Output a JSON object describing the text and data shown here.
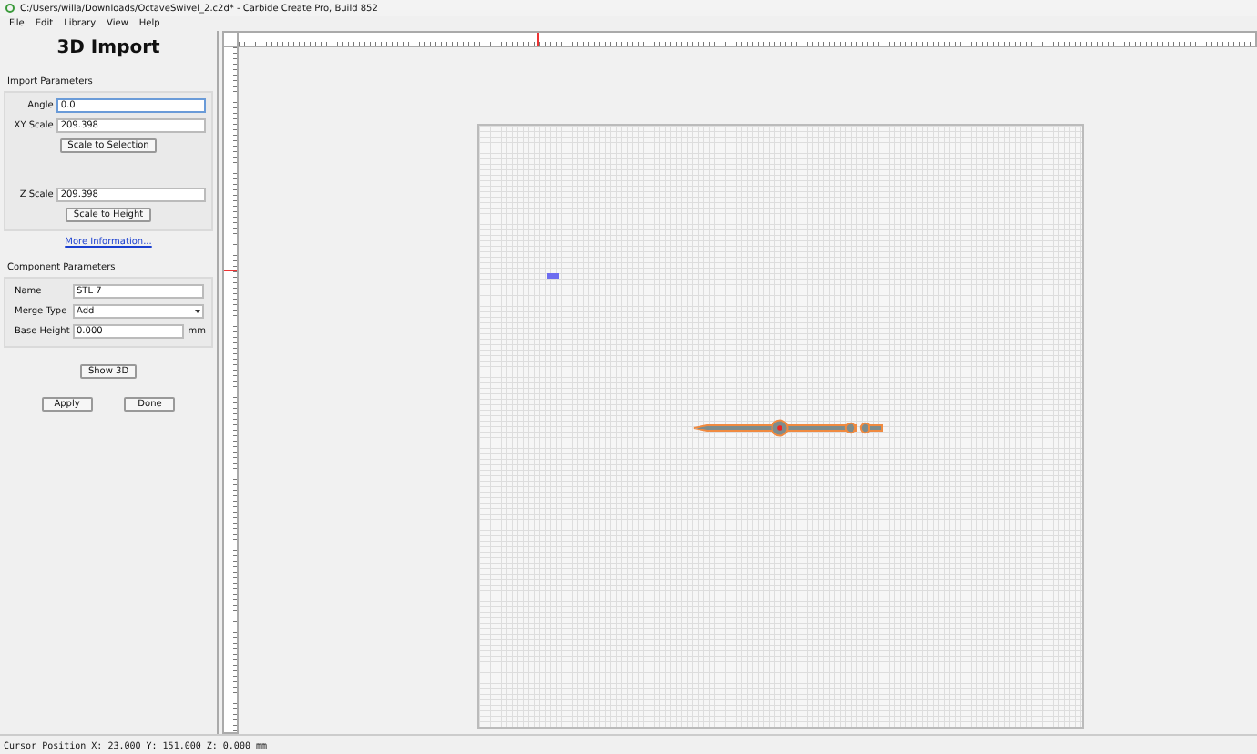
{
  "window": {
    "title": "C:/Users/willa/Downloads/OctaveSwivel_2.c2d* - Carbide Create Pro, Build 852"
  },
  "menu": [
    "File",
    "Edit",
    "Library",
    "View",
    "Help"
  ],
  "panel": {
    "title": "3D Import",
    "import_parameters": {
      "heading": "Import Parameters",
      "fields": [
        {
          "label": "Angle",
          "value": "0.0",
          "focused": true
        },
        {
          "label": "XY Scale",
          "value": "209.398",
          "focused": false
        }
      ],
      "scale_button": "Scale to Selection",
      "z_field": {
        "label": "Z Scale",
        "value": "209.398"
      },
      "height_button": "Scale to Height",
      "link": "More Information..."
    },
    "component_parameters": {
      "heading": "Component Parameters",
      "rows": [
        {
          "kind": "text",
          "label": "Name",
          "value": "STL 7"
        },
        {
          "kind": "select",
          "label": "Merge Type",
          "value": "Add"
        },
        {
          "kind": "text",
          "label": "Base Height",
          "value": "0.000",
          "unit": "mm"
        }
      ]
    },
    "show_button": "Show 3D",
    "buttons": [
      "Apply",
      "Done"
    ]
  },
  "status_bar": "Cursor Position X: 23.000 Y: 151.000 Z: 0.000 mm"
}
